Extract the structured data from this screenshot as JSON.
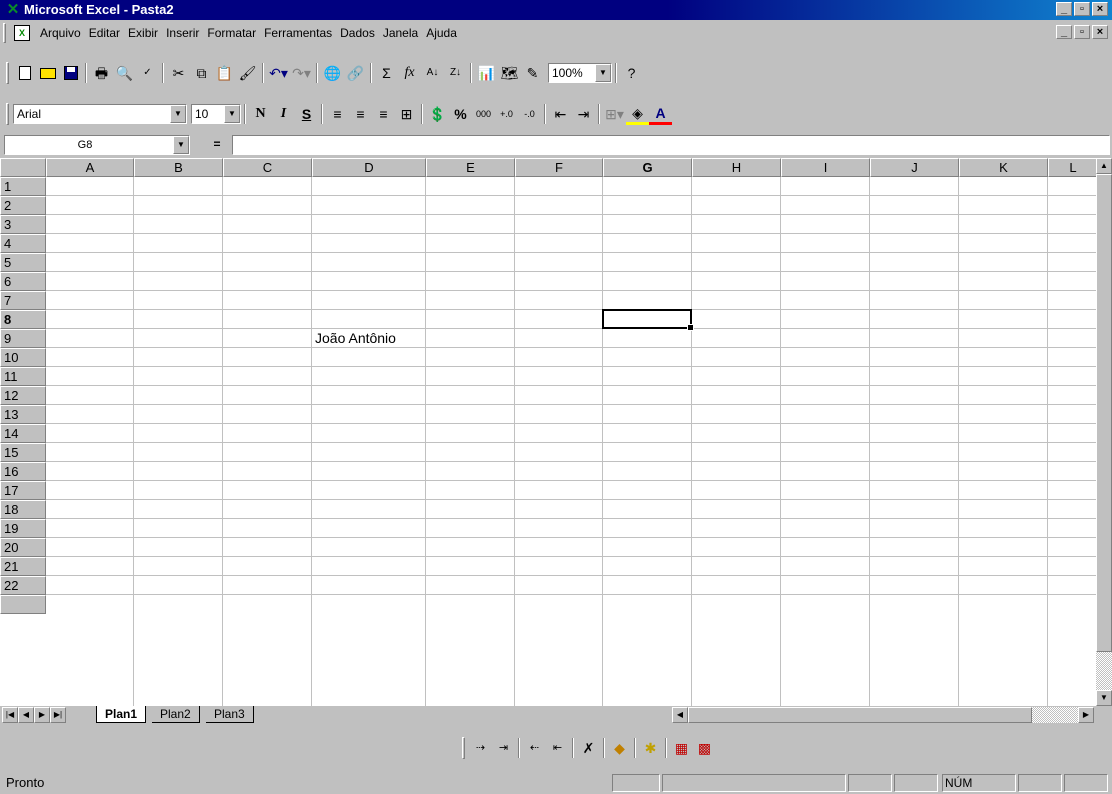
{
  "window": {
    "title": "Microsoft Excel - Pasta2",
    "app_icon": "excel-x-icon",
    "buttons": {
      "minimize": "_",
      "maximize": "▫",
      "close": "×"
    }
  },
  "menu": {
    "items": [
      "Arquivo",
      "Editar",
      "Exibir",
      "Inserir",
      "Formatar",
      "Ferramentas",
      "Dados",
      "Janela",
      "Ajuda"
    ]
  },
  "standard_toolbar": {
    "buttons": [
      "new-icon",
      "open-icon",
      "save-icon",
      "print-icon",
      "print-preview-icon",
      "spelling-icon",
      "cut-icon",
      "copy-icon",
      "paste-icon",
      "format-painter-icon",
      "undo-icon",
      "redo-icon",
      "web-toolbar-icon",
      "hyperlink-icon",
      "autosum-icon",
      "paste-function-icon",
      "sort-ascending-icon",
      "sort-descending-icon",
      "chart-wizard-icon",
      "map-icon",
      "drawing-icon",
      "help-icon"
    ],
    "zoom": "100%"
  },
  "format_toolbar": {
    "font": "Arial",
    "size": "10",
    "bold": "N",
    "italic": "I",
    "underline": "S",
    "percent": "%",
    "thousands": "000"
  },
  "formula_bar": {
    "name_box": "G8",
    "equals": "=",
    "content": ""
  },
  "sheet": {
    "columns": [
      "A",
      "B",
      "C",
      "D",
      "E",
      "F",
      "G",
      "H",
      "I",
      "J",
      "K",
      "L"
    ],
    "rows": [
      "1",
      "2",
      "3",
      "4",
      "5",
      "6",
      "7",
      "8",
      "9",
      "10",
      "11",
      "12",
      "13",
      "14",
      "15",
      "16",
      "17",
      "18",
      "19",
      "20",
      "21",
      "22"
    ],
    "active_column": "G",
    "active_row": "8",
    "cells": [
      {
        "ref": "D9",
        "value": "João Antônio"
      }
    ]
  },
  "tabs": {
    "sheets": [
      "Plan1",
      "Plan2",
      "Plan3"
    ],
    "active": "Plan1"
  },
  "status": {
    "text": "Pronto",
    "num": "NÚM"
  }
}
